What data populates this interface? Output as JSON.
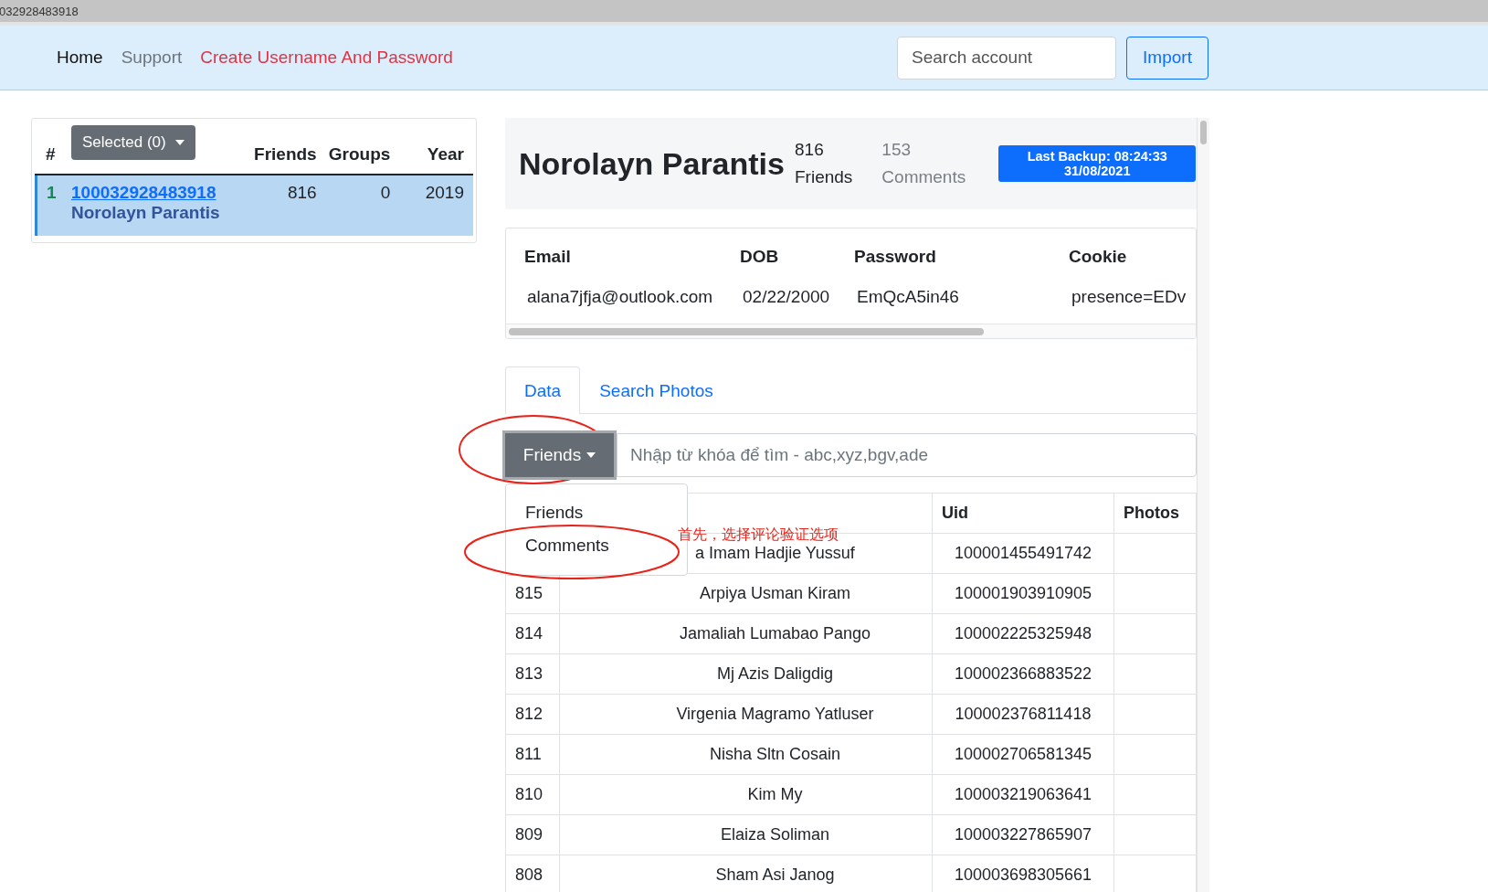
{
  "browser_strip": {
    "text": "032928483918"
  },
  "navbar": {
    "links": [
      {
        "label": "Home",
        "kind": "active"
      },
      {
        "label": "Support",
        "kind": "muted"
      },
      {
        "label": "Create Username And Password",
        "kind": "danger"
      }
    ],
    "search": {
      "placeholder": "Search account"
    },
    "import_button": "Import"
  },
  "accounts_table": {
    "columns": [
      "#",
      "Friends",
      "Groups",
      "Year"
    ],
    "selected_button": "Selected (0)",
    "rows": [
      {
        "index": "1",
        "uid": "100032928483918",
        "name": "Norolayn Parantis",
        "friends": "816",
        "groups": "0",
        "year": "2019",
        "selected": true
      }
    ]
  },
  "profile": {
    "name": "Norolayn Parantis",
    "stats": [
      {
        "value": "816",
        "label": "Friends",
        "selected": true
      },
      {
        "value": "153",
        "label": "Comments",
        "selected": false
      }
    ],
    "backup_badge": [
      "Last Backup: 08:24:33",
      "31/08/2021"
    ]
  },
  "details": {
    "columns": [
      "Email",
      "DOB",
      "Password",
      "Cookie"
    ],
    "values": [
      "alana7jfja@outlook.com",
      "02/22/2000",
      "EmQcA5in46",
      "presence=EDv"
    ]
  },
  "tabs": [
    {
      "label": "Data",
      "selected": true
    },
    {
      "label": "Search Photos",
      "selected": false
    }
  ],
  "filter": {
    "button": "Friends",
    "placeholder": "Nhập từ khóa để tìm - abc,xyz,bgv,ade",
    "menu": [
      "Friends",
      "Comments"
    ]
  },
  "annotation": "首先，选择评论验证选项",
  "friends_table": {
    "columns": [
      "Uid",
      "Photos"
    ],
    "rows": [
      {
        "name": "a Imam Hadjie Yussuf",
        "uid": "100001455491742"
      },
      {
        "index": "815",
        "name": "Arpiya Usman Kiram",
        "uid": "100001903910905"
      },
      {
        "index": "814",
        "name": "Jamaliah Lumabao Pango",
        "uid": "100002225325948"
      },
      {
        "index": "813",
        "name": "Mj Azis Daligdig",
        "uid": "100002366883522"
      },
      {
        "index": "812",
        "name": "Virgenia Magramo Yatluser",
        "uid": "100002376811418"
      },
      {
        "index": "811",
        "name": "Nisha Sltn Cosain",
        "uid": "100002706581345"
      },
      {
        "index": "810",
        "name": "Kim My",
        "uid": "100003219063641"
      },
      {
        "index": "809",
        "name": "Elaiza Soliman",
        "uid": "100003227865907"
      },
      {
        "index": "808",
        "name": "Sham Asi Janog",
        "uid": "100003698305661"
      }
    ]
  }
}
